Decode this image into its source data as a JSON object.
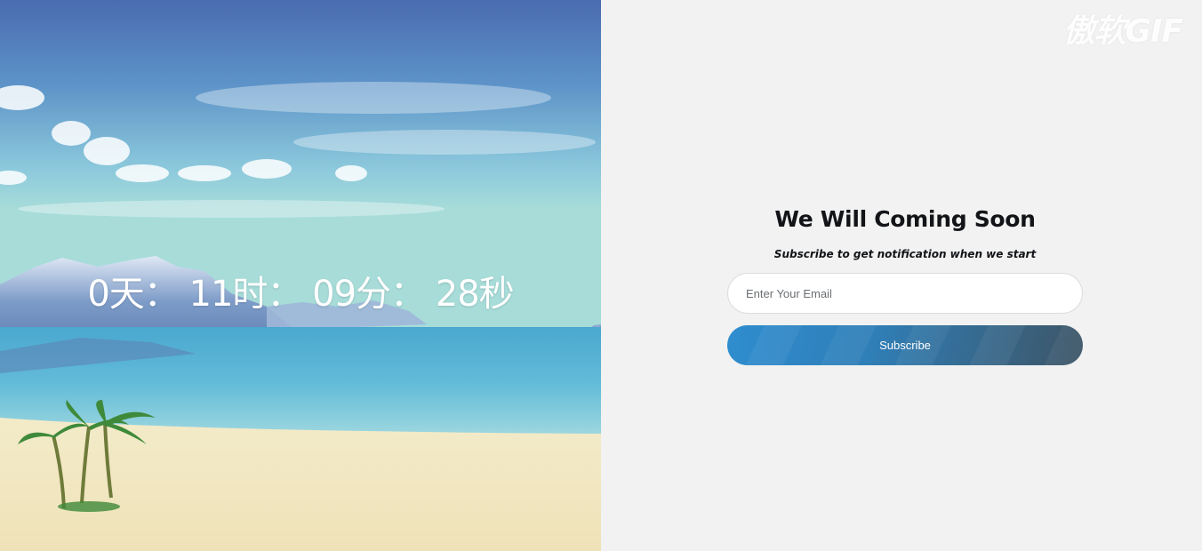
{
  "countdown": {
    "days": "0",
    "days_unit": "天：",
    "hours": "11",
    "hours_unit": "时：",
    "minutes": "09",
    "minutes_unit": "分：",
    "seconds": "28",
    "seconds_unit": "秒"
  },
  "watermark": "傲软GIF",
  "form": {
    "title": "We Will Coming Soon",
    "subtitle": "Subscribe to get notification when we start",
    "email_placeholder": "Enter Your Email",
    "subscribe_label": "Subscribe"
  },
  "colors": {
    "right_background": "#f1f2f1",
    "button_start": "#2f8dcf",
    "button_end": "#3d5566"
  }
}
